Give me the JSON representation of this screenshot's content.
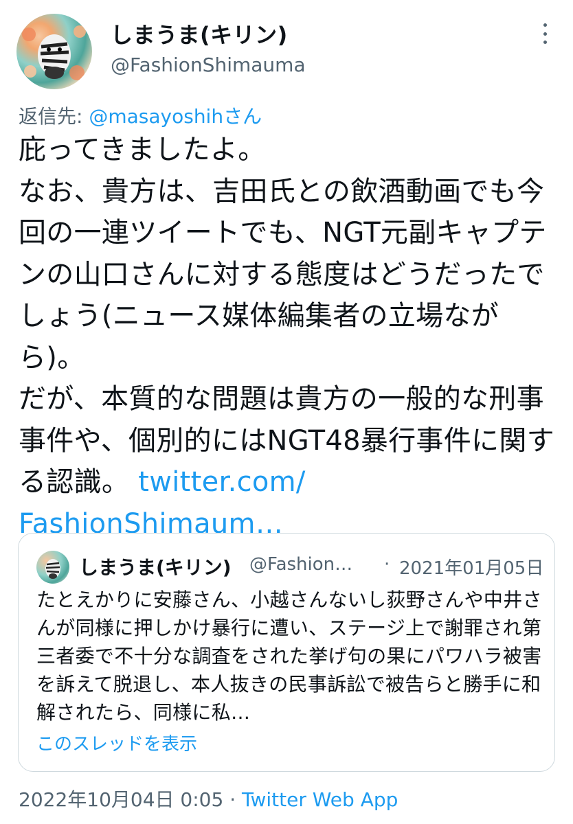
{
  "tweet": {
    "author_name": "しまうま(キリン)",
    "author_handle": "@FashionShimauma",
    "more_icon": "more-vertical-icon",
    "reply_label": "返信先: ",
    "reply_user": "@masayoshihさん",
    "text": "庇ってきましたよ。\nなお、貴方は、吉田氏との飲酒動画でも今回の一連ツイートでも、NGT元副キャプテンの山口さんに対する態度はどうだったでしょう(ニュース媒体編集者の立場ながら)。\nだが、本質的な問題は貴方の一般的な刑事事件や、個別的にはNGT48暴行事件に関する認識。",
    "link_line1": "twitter.com/",
    "link_line2": "FashionShimaum…",
    "timestamp": "2022年10月04日 0:05",
    "separator": "·",
    "source": "Twitter Web App"
  },
  "quoted": {
    "author_name": "しまうま(キリン)",
    "author_handle": "@Fashion…",
    "separator": "·",
    "date": "2021年01月05日",
    "text": "たとえかりに安藤さん、小越さんないし荻野さんや中井さんが同様に押しかけ暴行に遭い、ステージ上で謝罪され第三者委で不十分な調査をされた挙げ句の果にパワハラ被害を訴えて脱退し、本人抜きの民事訴訟で被告らと勝手に和解されたら、同様に私…",
    "show_thread": "このスレッドを表示"
  },
  "colors": {
    "link": "#1d9bf0",
    "secondary_text": "#536471",
    "border": "#cfd9de"
  }
}
